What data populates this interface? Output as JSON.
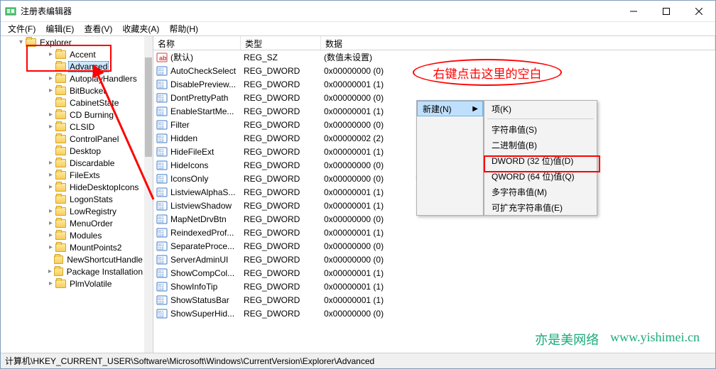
{
  "title": "注册表编辑器",
  "menus": {
    "file": "文件(F)",
    "edit": "编辑(E)",
    "view": "查看(V)",
    "fav": "收藏夹(A)",
    "help": "帮助(H)"
  },
  "tree": {
    "root": "Explorer",
    "items": [
      {
        "label": "Accent",
        "exp": "collapsed",
        "indent": 3
      },
      {
        "label": "Advanced",
        "exp": "none",
        "indent": 3,
        "selected": true
      },
      {
        "label": "AutoplayHandlers",
        "exp": "collapsed",
        "indent": 3
      },
      {
        "label": "BitBucket",
        "exp": "collapsed",
        "indent": 3
      },
      {
        "label": "CabinetState",
        "exp": "none",
        "indent": 3
      },
      {
        "label": "CD Burning",
        "exp": "collapsed",
        "indent": 3
      },
      {
        "label": "CLSID",
        "exp": "collapsed",
        "indent": 3
      },
      {
        "label": "ControlPanel",
        "exp": "none",
        "indent": 3
      },
      {
        "label": "Desktop",
        "exp": "none",
        "indent": 3
      },
      {
        "label": "Discardable",
        "exp": "collapsed",
        "indent": 3
      },
      {
        "label": "FileExts",
        "exp": "collapsed",
        "indent": 3
      },
      {
        "label": "HideDesktopIcons",
        "exp": "collapsed",
        "indent": 3
      },
      {
        "label": "LogonStats",
        "exp": "none",
        "indent": 3
      },
      {
        "label": "LowRegistry",
        "exp": "collapsed",
        "indent": 3
      },
      {
        "label": "MenuOrder",
        "exp": "collapsed",
        "indent": 3
      },
      {
        "label": "Modules",
        "exp": "collapsed",
        "indent": 3
      },
      {
        "label": "MountPoints2",
        "exp": "collapsed",
        "indent": 3
      },
      {
        "label": "NewShortcutHandle",
        "exp": "none",
        "indent": 3
      },
      {
        "label": "Package Installation",
        "exp": "collapsed",
        "indent": 3
      },
      {
        "label": "PlmVolatile",
        "exp": "collapsed",
        "indent": 3
      }
    ]
  },
  "columns": {
    "name": "名称",
    "type": "类型",
    "data": "数据"
  },
  "rows": [
    {
      "icon": "str",
      "name": "(默认)",
      "type": "REG_SZ",
      "data": "(数值未设置)"
    },
    {
      "icon": "bin",
      "name": "AutoCheckSelect",
      "type": "REG_DWORD",
      "data": "0x00000000 (0)"
    },
    {
      "icon": "bin",
      "name": "DisablePreview...",
      "type": "REG_DWORD",
      "data": "0x00000001 (1)"
    },
    {
      "icon": "bin",
      "name": "DontPrettyPath",
      "type": "REG_DWORD",
      "data": "0x00000000 (0)"
    },
    {
      "icon": "bin",
      "name": "EnableStartMe...",
      "type": "REG_DWORD",
      "data": "0x00000001 (1)"
    },
    {
      "icon": "bin",
      "name": "Filter",
      "type": "REG_DWORD",
      "data": "0x00000000 (0)"
    },
    {
      "icon": "bin",
      "name": "Hidden",
      "type": "REG_DWORD",
      "data": "0x00000002 (2)"
    },
    {
      "icon": "bin",
      "name": "HideFileExt",
      "type": "REG_DWORD",
      "data": "0x00000001 (1)"
    },
    {
      "icon": "bin",
      "name": "HideIcons",
      "type": "REG_DWORD",
      "data": "0x00000000 (0)"
    },
    {
      "icon": "bin",
      "name": "IconsOnly",
      "type": "REG_DWORD",
      "data": "0x00000000 (0)"
    },
    {
      "icon": "bin",
      "name": "ListviewAlphaS...",
      "type": "REG_DWORD",
      "data": "0x00000001 (1)"
    },
    {
      "icon": "bin",
      "name": "ListviewShadow",
      "type": "REG_DWORD",
      "data": "0x00000001 (1)"
    },
    {
      "icon": "bin",
      "name": "MapNetDrvBtn",
      "type": "REG_DWORD",
      "data": "0x00000000 (0)"
    },
    {
      "icon": "bin",
      "name": "ReindexedProf...",
      "type": "REG_DWORD",
      "data": "0x00000001 (1)"
    },
    {
      "icon": "bin",
      "name": "SeparateProce...",
      "type": "REG_DWORD",
      "data": "0x00000000 (0)"
    },
    {
      "icon": "bin",
      "name": "ServerAdminUI",
      "type": "REG_DWORD",
      "data": "0x00000000 (0)"
    },
    {
      "icon": "bin",
      "name": "ShowCompCol...",
      "type": "REG_DWORD",
      "data": "0x00000001 (1)"
    },
    {
      "icon": "bin",
      "name": "ShowInfoTip",
      "type": "REG_DWORD",
      "data": "0x00000001 (1)"
    },
    {
      "icon": "bin",
      "name": "ShowStatusBar",
      "type": "REG_DWORD",
      "data": "0x00000001 (1)"
    },
    {
      "icon": "bin",
      "name": "ShowSuperHid...",
      "type": "REG_DWORD",
      "data": "0x00000000 (0)"
    }
  ],
  "context": {
    "new": "新建(N)",
    "sub": [
      {
        "label": "项(K)"
      },
      {
        "sep": true
      },
      {
        "label": "字符串值(S)"
      },
      {
        "label": "二进制值(B)"
      },
      {
        "label": "DWORD (32 位)值(D)",
        "highlight": true
      },
      {
        "label": "QWORD (64 位)值(Q)"
      },
      {
        "label": "多字符串值(M)"
      },
      {
        "label": "可扩充字符串值(E)"
      }
    ]
  },
  "callout": "右键点击这里的空白",
  "watermark": {
    "a": "亦是美网络",
    "b": "www.yishimei.cn"
  },
  "statusbar": "计算机\\HKEY_CURRENT_USER\\Software\\Microsoft\\Windows\\CurrentVersion\\Explorer\\Advanced"
}
